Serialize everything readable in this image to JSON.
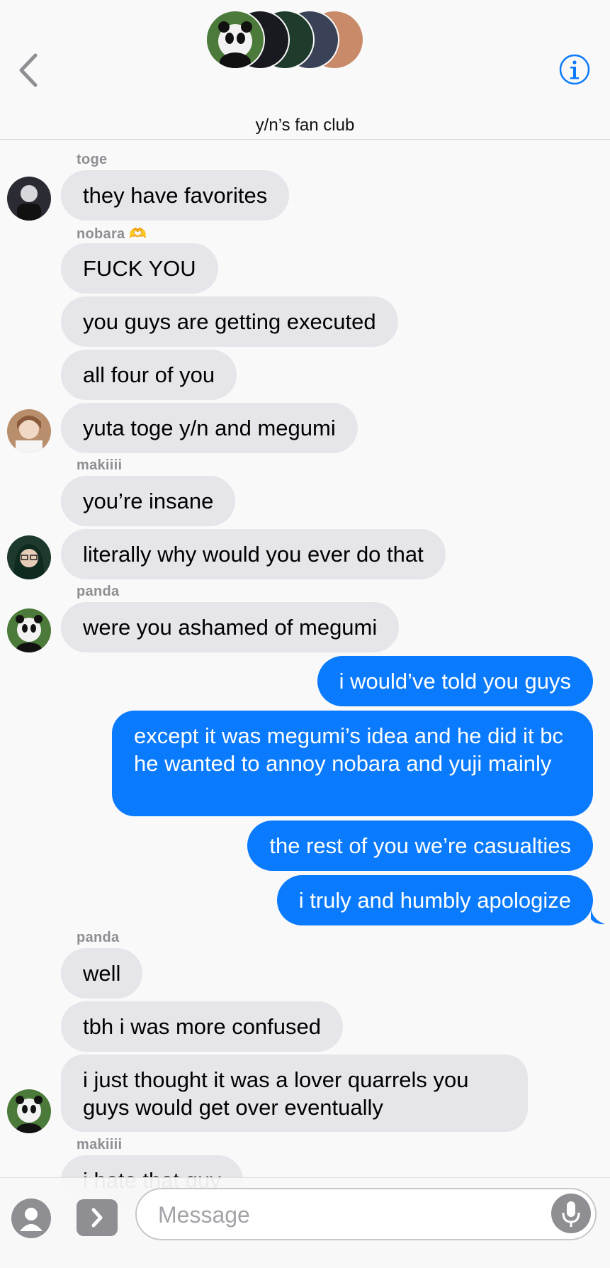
{
  "header": {
    "title": "y/n’s fan club",
    "back_icon": "chevron-left-icon",
    "info_icon": "info-icon",
    "accent": "#0a7aff"
  },
  "messages": [
    {
      "sender": "toge",
      "text": "they have favorites"
    },
    {
      "sender": "nobara 🫶",
      "text": "FUCK YOU"
    },
    {
      "text": "you guys are getting executed"
    },
    {
      "text": "all four of you"
    },
    {
      "text": "yuta toge y/n and megumi"
    },
    {
      "sender": "makiiii",
      "text": "you’re insane"
    },
    {
      "text": "literally why would you ever do that"
    },
    {
      "sender": "panda",
      "text": "were you ashamed of megumi"
    },
    {
      "text": "i would’ve told you guys"
    },
    {
      "text": "except it was megumi’s idea and he did it bc he wanted to annoy nobara and yuji mainly"
    },
    {
      "text": "the rest of you we’re casualties"
    },
    {
      "text": "i truly and humbly apologize"
    },
    {
      "sender": "panda",
      "text": "well"
    },
    {
      "text": "tbh i was more confused"
    },
    {
      "text": "i just thought it was a lover quarrels you guys would get over eventually"
    },
    {
      "sender": "makiiii",
      "text": "i hate that guy"
    }
  ],
  "input": {
    "placeholder": "Message",
    "camera_icon": "camera-icon",
    "apps_icon": "apps-chevron-icon",
    "mic_icon": "microphone-icon"
  },
  "colors": {
    "incoming_bubble": "#e6e5ea",
    "outgoing_bubble": "#0a7aff",
    "sender_label": "#8e8e93"
  }
}
